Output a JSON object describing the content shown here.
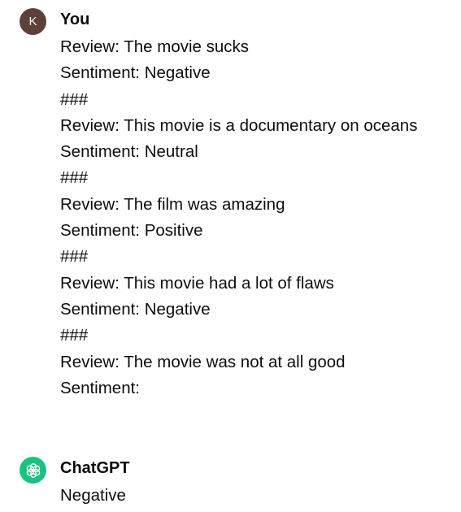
{
  "conversation": {
    "user": {
      "avatar_letter": "K",
      "avatar_color": "#5d4037",
      "name": "You",
      "lines": [
        "Review: The movie sucks",
        "Sentiment: Negative",
        "###",
        "Review: This movie is a documentary on oceans",
        "Sentiment: Neutral",
        "###",
        "Review: The film was amazing",
        "Sentiment: Positive",
        "###",
        "Review: This movie had a lot of flaws",
        "Sentiment: Negative",
        "###",
        "Review: The movie was not at all good",
        "Sentiment:"
      ]
    },
    "assistant": {
      "avatar_icon": "openai-logo-icon",
      "avatar_color": "#19c37d",
      "name": "ChatGPT",
      "lines": [
        "Negative"
      ]
    }
  }
}
